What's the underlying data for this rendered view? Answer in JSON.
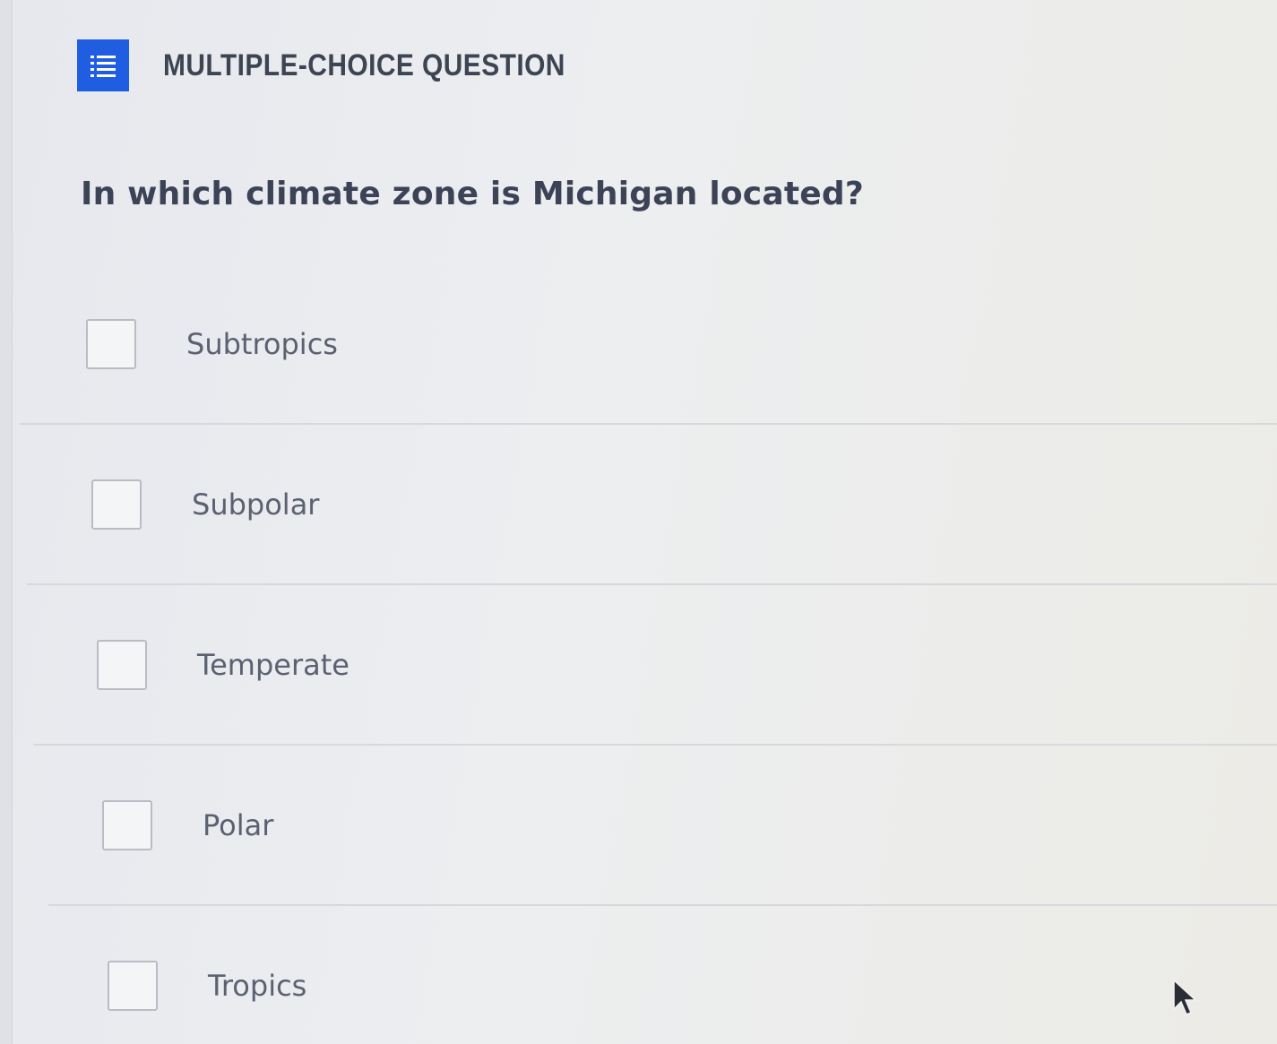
{
  "question_type": "MULTIPLE-CHOICE QUESTION",
  "question": "In which climate zone is Michigan located?",
  "answers": [
    {
      "label": "Subtropics",
      "checked": false
    },
    {
      "label": "Subpolar",
      "checked": false
    },
    {
      "label": "Temperate",
      "checked": false
    },
    {
      "label": "Polar",
      "checked": false
    },
    {
      "label": "Tropics",
      "checked": false
    }
  ],
  "icons": {
    "question_type_icon": "list-icon",
    "cursor": "mouse-pointer-icon"
  },
  "colors": {
    "accent": "#1f5ee0",
    "question_text": "#3d4357",
    "answer_text": "#5b6170"
  }
}
